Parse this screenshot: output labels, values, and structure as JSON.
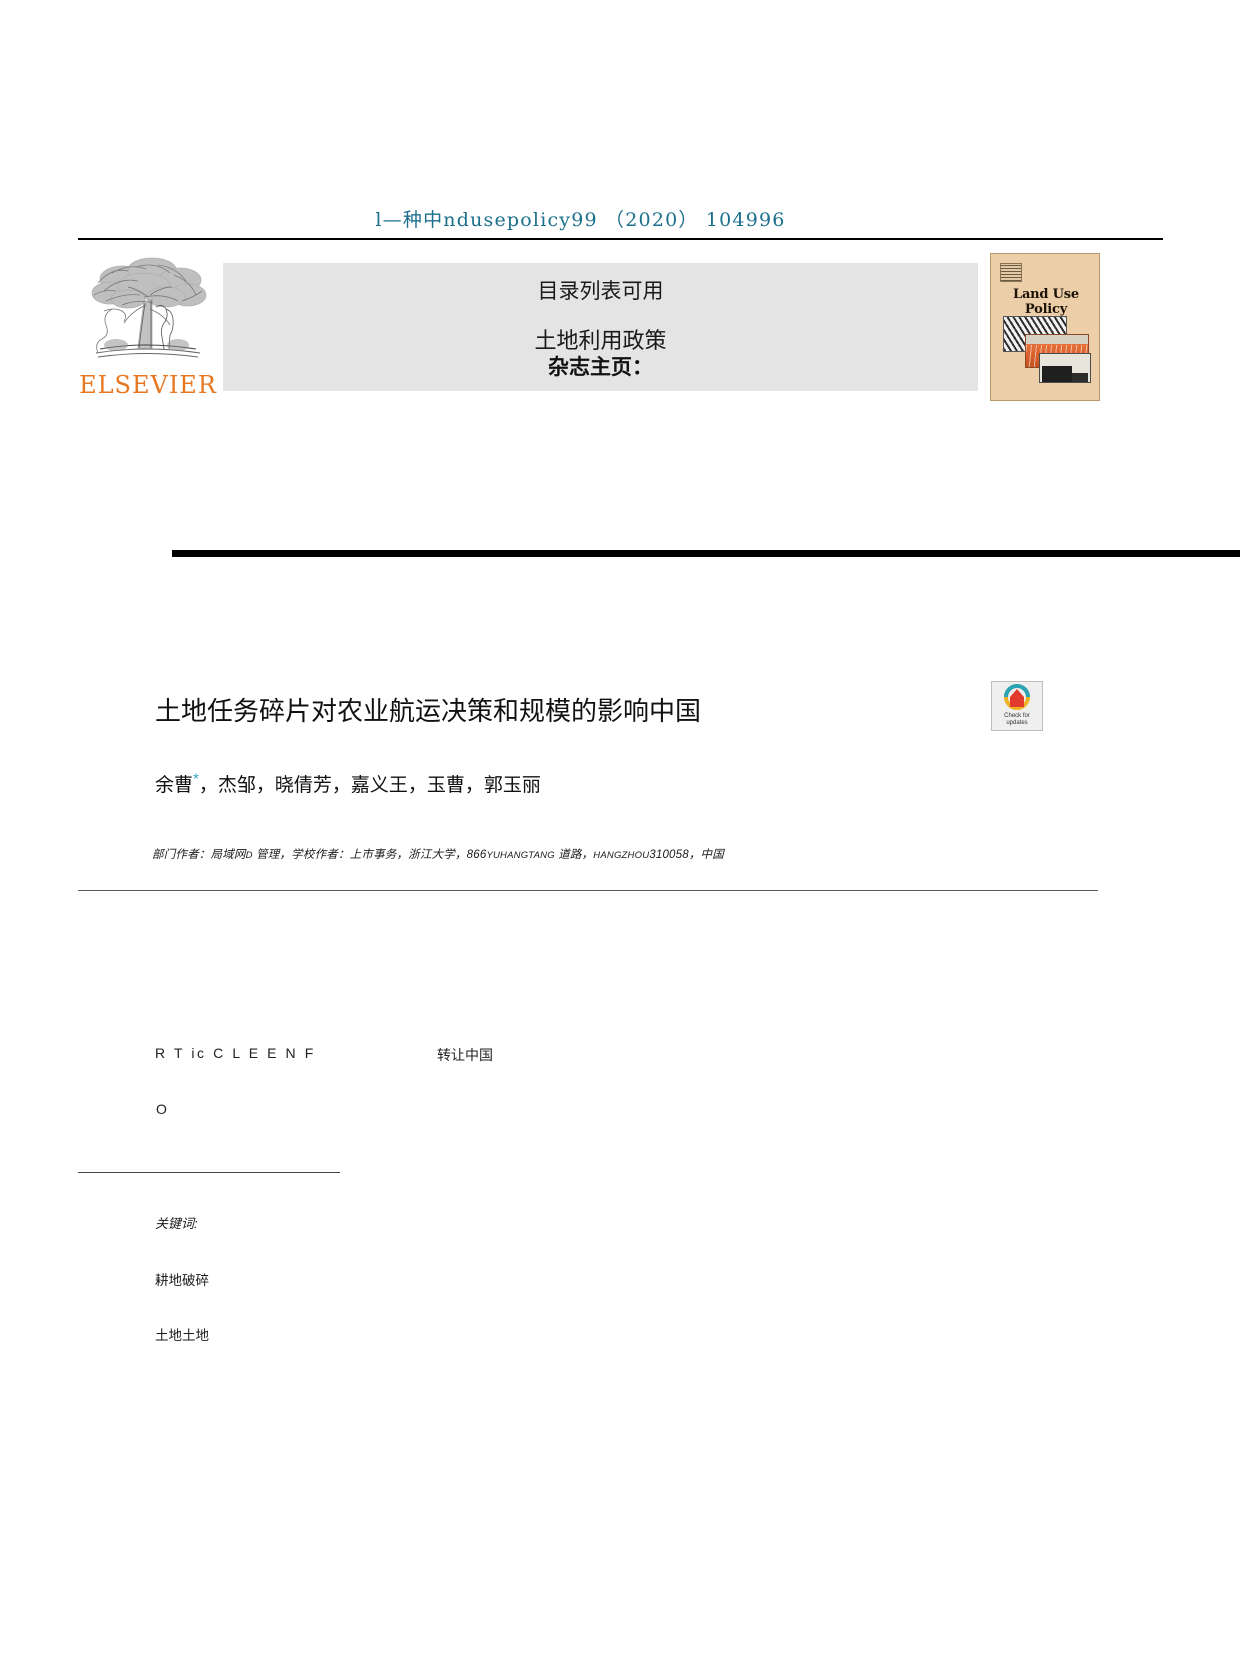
{
  "running_head": {
    "citation": "l—种中ndusepolicy99 （2020） 104996",
    "color": "#1b6f8c"
  },
  "masthead": {
    "publisher_logo_name": "ELSEVIER",
    "publisher_wordmark": "ELSEVIER",
    "publisher_color": "#e87722",
    "contents_line": "目录列表可用",
    "journal_name": "土地利用政策",
    "homepage_label": "杂志主页：",
    "band_color": "#e4e4e4",
    "cover": {
      "title": "Land Use Policy",
      "background": "#eccfa8"
    }
  },
  "article": {
    "title": "土地任务碎片对农业航运决策和规模的影响中国",
    "authors": "余曹",
    "authors_rest": "，杰邹，晓倩芳，嘉义王，玉曹，郭玉丽",
    "corresponding_mark": "*",
    "affiliation_part1": "部门作者：局域网",
    "affiliation_sc1": "D",
    "affiliation_part2": " 管理，学校作者：上市事务，浙江大学，866",
    "affiliation_sc2": "YUHANGTANG",
    "affiliation_part3": " 道路，",
    "affiliation_sc3": "HANGZHOU",
    "affiliation_part4": "310058，中国",
    "crossmark": {
      "line1": "Check for",
      "line2": "updates"
    }
  },
  "info_block": {
    "article_info_head": "R T ic C L E E N F",
    "abstract_head": "转让中国",
    "stray_char": "O",
    "keywords_label": "关键词:",
    "keywords": [
      "耕地破碎",
      "土地土地"
    ]
  }
}
